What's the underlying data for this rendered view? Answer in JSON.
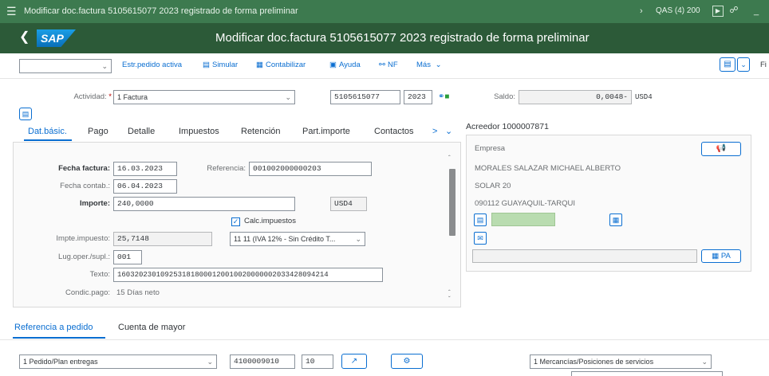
{
  "window": {
    "title": "Modificar doc.factura 5105615077 2023 registrado de forma preliminar",
    "system": "QAS (4) 200"
  },
  "shell": {
    "logo": "SAP",
    "title": "Modificar doc.factura 5105615077 2023 registrado de forma preliminar"
  },
  "toolbar": {
    "select_value": "",
    "items": [
      {
        "label": "Estr.pedido activa",
        "icon": ""
      },
      {
        "label": "Simular",
        "icon": "simulate-icon"
      },
      {
        "label": "Contabilizar",
        "icon": "post-icon"
      },
      {
        "label": "Ayuda",
        "icon": "help-icon"
      },
      {
        "label": "NF",
        "icon": "nf-icon"
      },
      {
        "label": "Más",
        "icon": "chevron-down-icon"
      }
    ],
    "right_truncated": "Fi"
  },
  "header": {
    "actividad_label": "Actividad:",
    "actividad_value": "1 Factura",
    "doc_number": "5105615077",
    "doc_year": "2023",
    "saldo_label": "Saldo:",
    "saldo_value": "0,0048-",
    "saldo_currency": "USD4"
  },
  "tabs": [
    "Dat.básic.",
    "Pago",
    "Detalle",
    "Impuestos",
    "Retención",
    "Part.importe",
    "Contactos"
  ],
  "basic": {
    "fecha_factura_label": "Fecha factura:",
    "fecha_factura": "16.03.2023",
    "referencia_label": "Referencia:",
    "referencia": "001002000000203",
    "fecha_contab_label": "Fecha contab.:",
    "fecha_contab": "06.04.2023",
    "importe_label": "Importe:",
    "importe": "240,0000",
    "importe_currency": "USD4",
    "calc_impuestos_label": "Calc.impuestos",
    "calc_impuestos_checked": true,
    "impte_impuesto_label": "Impte.impuesto:",
    "impte_impuesto": "25,7148",
    "tax_code": "11 11 (IVA 12% - Sin Crédito T...",
    "lug_oper_label": "Lug.oper./supl.:",
    "lug_oper": "001",
    "texto_label": "Texto:",
    "texto": "1603202301092531818000120010020000002033428094214",
    "condic_pago_label": "Condic.pago:",
    "condic_pago": "15 Días neto"
  },
  "vendor": {
    "title": "Acreedor 1000007871",
    "empresa_label": "Empresa",
    "name": "MORALES SALAZAR MICHAEL ALBERTO",
    "street": "SOLAR 20",
    "city": "090112 GUAYAQUIL-TARQUI",
    "pa_label": "PA"
  },
  "bottom_tabs": [
    "Referencia a pedido",
    "Cuenta de mayor"
  ],
  "po_ref": {
    "type": "1 Pedido/Plan entregas",
    "po_number": "4100009010",
    "item": "10",
    "goods_type": "1 Mercancías/Posiciones de servicios"
  },
  "colors": {
    "title_bar": "#3d7a4f",
    "shell_bar": "#2c5a38",
    "accent": "#0a6ed1",
    "vendor_field_fill": "#b9dcb0"
  }
}
